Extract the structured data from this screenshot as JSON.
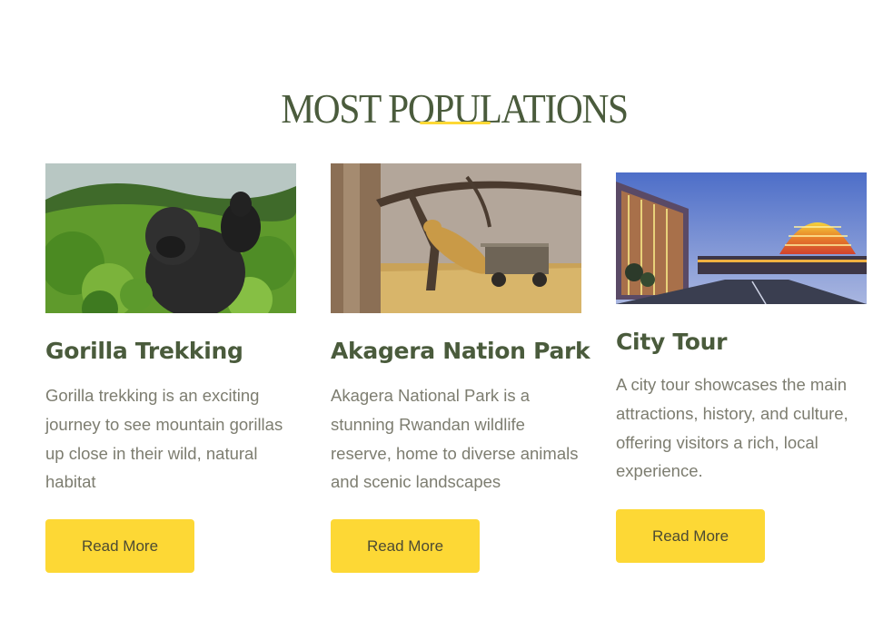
{
  "section": {
    "title": "MOST POPULATIONS"
  },
  "cards": [
    {
      "title": "Gorilla Trekking",
      "description": "Gorilla trekking is an exciting journey to see mountain gorillas up close in their wild, natural habitat",
      "button_label": "Read More",
      "image_subject": "mountain gorillas in green forest"
    },
    {
      "title": "Akagera Nation Park",
      "description": "Akagera National Park is a stunning Rwandan wildlife reserve, home to diverse animals and scenic landscapes",
      "button_label": "Read More",
      "image_subject": "leopard leaping from acacia tree near safari vehicle"
    },
    {
      "title": "City Tour",
      "description": "A city tour showcases the main attractions, history, and culture, offering visitors a rich, local experience.",
      "button_label": "Read More",
      "image_subject": "Kigali convention center dome at dusk"
    }
  ],
  "colors": {
    "heading": "#4a5b3c",
    "accent": "#fdd835",
    "body_text": "#7d7d70"
  }
}
